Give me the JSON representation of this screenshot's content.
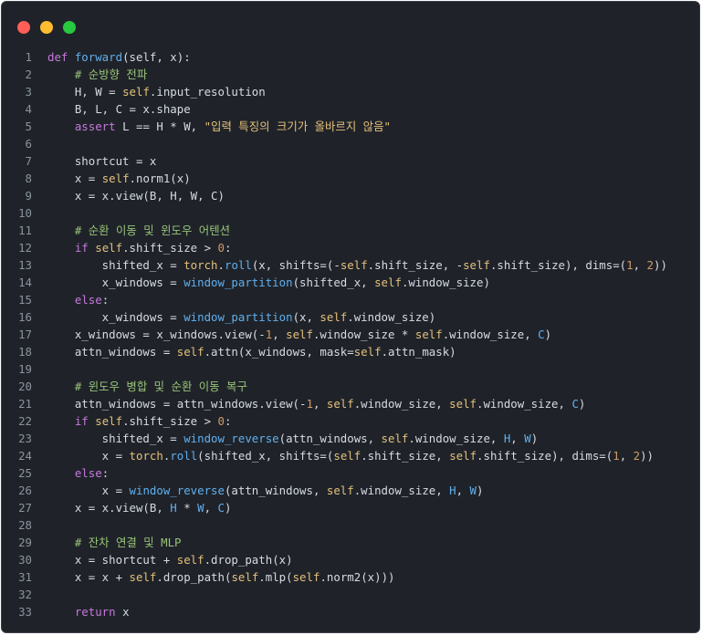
{
  "window": {
    "buttons": [
      {
        "name": "close",
        "color": "#ff5f57"
      },
      {
        "name": "minimize",
        "color": "#febc2e"
      },
      {
        "name": "zoom",
        "color": "#28c840"
      }
    ]
  },
  "theme": {
    "background": "#1f2329",
    "text": "#d6dbe2",
    "keyword": "#c678dd",
    "function": "#61afef",
    "comment": "#98c379",
    "string": "#e5c07b",
    "number": "#d19a66",
    "line_number": "#8b939e"
  },
  "code": {
    "lines": [
      {
        "n": "1",
        "tokens": [
          [
            "kw",
            "def "
          ],
          [
            "fn",
            "forward"
          ],
          [
            "op",
            "(self, x):"
          ]
        ]
      },
      {
        "n": "2",
        "tokens": [
          [
            "op",
            "    "
          ],
          [
            "cm",
            "# 순방향 전파"
          ]
        ]
      },
      {
        "n": "3",
        "tokens": [
          [
            "op",
            "    H, W = "
          ],
          [
            "self",
            "self"
          ],
          [
            "op",
            ".input_resolution"
          ]
        ]
      },
      {
        "n": "4",
        "tokens": [
          [
            "op",
            "    B, L, C = x.shape"
          ]
        ]
      },
      {
        "n": "5",
        "tokens": [
          [
            "op",
            "    "
          ],
          [
            "kw",
            "assert "
          ],
          [
            "op",
            "L == H * W, "
          ],
          [
            "str",
            "\"입력 특징의 크기가 올바르지 않음\""
          ]
        ]
      },
      {
        "n": "6",
        "tokens": []
      },
      {
        "n": "7",
        "tokens": [
          [
            "op",
            "    shortcut = x"
          ]
        ]
      },
      {
        "n": "8",
        "tokens": [
          [
            "op",
            "    x = "
          ],
          [
            "self",
            "self"
          ],
          [
            "op",
            ".norm1(x)"
          ]
        ]
      },
      {
        "n": "9",
        "tokens": [
          [
            "op",
            "    x = x.view(B, H, W, C)"
          ]
        ]
      },
      {
        "n": "10",
        "tokens": []
      },
      {
        "n": "11",
        "tokens": [
          [
            "op",
            "    "
          ],
          [
            "cm",
            "# 순환 이동 및 윈도우 어텐션"
          ]
        ]
      },
      {
        "n": "12",
        "tokens": [
          [
            "op",
            "    "
          ],
          [
            "kw",
            "if "
          ],
          [
            "self",
            "self"
          ],
          [
            "op",
            ".shift_size > "
          ],
          [
            "num",
            "0"
          ],
          [
            "op",
            ":"
          ]
        ]
      },
      {
        "n": "13",
        "tokens": [
          [
            "op",
            "        shifted_x = "
          ],
          [
            "mod",
            "torch"
          ],
          [
            "op",
            "."
          ],
          [
            "fn",
            "roll"
          ],
          [
            "op",
            "(x, shifts=(-"
          ],
          [
            "self",
            "self"
          ],
          [
            "op",
            ".shift_size, -"
          ],
          [
            "self",
            "self"
          ],
          [
            "op",
            ".shift_size), dims=("
          ],
          [
            "num",
            "1"
          ],
          [
            "op",
            ", "
          ],
          [
            "num",
            "2"
          ],
          [
            "op",
            "))"
          ]
        ]
      },
      {
        "n": "14",
        "tokens": [
          [
            "op",
            "        x_windows = "
          ],
          [
            "fn",
            "window_partition"
          ],
          [
            "op",
            "(shifted_x, "
          ],
          [
            "self",
            "self"
          ],
          [
            "op",
            ".window_size)"
          ]
        ]
      },
      {
        "n": "15",
        "tokens": [
          [
            "op",
            "    "
          ],
          [
            "kw",
            "else"
          ],
          [
            "op",
            ":"
          ]
        ]
      },
      {
        "n": "16",
        "tokens": [
          [
            "op",
            "        x_windows = "
          ],
          [
            "fn",
            "window_partition"
          ],
          [
            "op",
            "(x, "
          ],
          [
            "self",
            "self"
          ],
          [
            "op",
            ".window_size)"
          ]
        ]
      },
      {
        "n": "17",
        "tokens": [
          [
            "op",
            "    x_windows = x_windows.view(-"
          ],
          [
            "num",
            "1"
          ],
          [
            "op",
            ", "
          ],
          [
            "self",
            "self"
          ],
          [
            "op",
            ".window_size * "
          ],
          [
            "self",
            "self"
          ],
          [
            "op",
            ".window_size, "
          ],
          [
            "cap",
            "C"
          ],
          [
            "op",
            ")"
          ]
        ]
      },
      {
        "n": "18",
        "tokens": [
          [
            "op",
            "    attn_windows = "
          ],
          [
            "self",
            "self"
          ],
          [
            "op",
            ".attn(x_windows, mask="
          ],
          [
            "self",
            "self"
          ],
          [
            "op",
            ".attn_mask)"
          ]
        ]
      },
      {
        "n": "19",
        "tokens": []
      },
      {
        "n": "20",
        "tokens": [
          [
            "op",
            "    "
          ],
          [
            "cm",
            "# 윈도우 병합 및 순환 이동 복구"
          ]
        ]
      },
      {
        "n": "21",
        "tokens": [
          [
            "op",
            "    attn_windows = attn_windows.view(-"
          ],
          [
            "num",
            "1"
          ],
          [
            "op",
            ", "
          ],
          [
            "self",
            "self"
          ],
          [
            "op",
            ".window_size, "
          ],
          [
            "self",
            "self"
          ],
          [
            "op",
            ".window_size, "
          ],
          [
            "cap",
            "C"
          ],
          [
            "op",
            ")"
          ]
        ]
      },
      {
        "n": "22",
        "tokens": [
          [
            "op",
            "    "
          ],
          [
            "kw",
            "if "
          ],
          [
            "self",
            "self"
          ],
          [
            "op",
            ".shift_size > "
          ],
          [
            "num",
            "0"
          ],
          [
            "op",
            ":"
          ]
        ]
      },
      {
        "n": "23",
        "tokens": [
          [
            "op",
            "        shifted_x = "
          ],
          [
            "fn",
            "window_reverse"
          ],
          [
            "op",
            "(attn_windows, "
          ],
          [
            "self",
            "self"
          ],
          [
            "op",
            ".window_size, "
          ],
          [
            "cap",
            "H"
          ],
          [
            "op",
            ", "
          ],
          [
            "cap",
            "W"
          ],
          [
            "op",
            ")"
          ]
        ]
      },
      {
        "n": "24",
        "tokens": [
          [
            "op",
            "        x = "
          ],
          [
            "mod",
            "torch"
          ],
          [
            "op",
            "."
          ],
          [
            "fn",
            "roll"
          ],
          [
            "op",
            "(shifted_x, shifts=("
          ],
          [
            "self",
            "self"
          ],
          [
            "op",
            ".shift_size, "
          ],
          [
            "self",
            "self"
          ],
          [
            "op",
            ".shift_size), dims=("
          ],
          [
            "num",
            "1"
          ],
          [
            "op",
            ", "
          ],
          [
            "num",
            "2"
          ],
          [
            "op",
            "))"
          ]
        ]
      },
      {
        "n": "25",
        "tokens": [
          [
            "op",
            "    "
          ],
          [
            "kw",
            "else"
          ],
          [
            "op",
            ":"
          ]
        ]
      },
      {
        "n": "26",
        "tokens": [
          [
            "op",
            "        x = "
          ],
          [
            "fn",
            "window_reverse"
          ],
          [
            "op",
            "(attn_windows, "
          ],
          [
            "self",
            "self"
          ],
          [
            "op",
            ".window_size, "
          ],
          [
            "cap",
            "H"
          ],
          [
            "op",
            ", "
          ],
          [
            "cap",
            "W"
          ],
          [
            "op",
            ")"
          ]
        ]
      },
      {
        "n": "27",
        "tokens": [
          [
            "op",
            "    x = x.view(B, "
          ],
          [
            "cap",
            "H"
          ],
          [
            "op",
            " * "
          ],
          [
            "cap",
            "W"
          ],
          [
            "op",
            ", "
          ],
          [
            "cap",
            "C"
          ],
          [
            "op",
            ")"
          ]
        ]
      },
      {
        "n": "28",
        "tokens": []
      },
      {
        "n": "29",
        "tokens": [
          [
            "op",
            "    "
          ],
          [
            "cm",
            "# 잔차 연결 및 MLP"
          ]
        ]
      },
      {
        "n": "30",
        "tokens": [
          [
            "op",
            "    x = shortcut + "
          ],
          [
            "self",
            "self"
          ],
          [
            "op",
            ".drop_path(x)"
          ]
        ]
      },
      {
        "n": "31",
        "tokens": [
          [
            "op",
            "    x = x + "
          ],
          [
            "self",
            "self"
          ],
          [
            "op",
            ".drop_path("
          ],
          [
            "self",
            "self"
          ],
          [
            "op",
            ".mlp("
          ],
          [
            "self",
            "self"
          ],
          [
            "op",
            ".norm2(x)))"
          ]
        ]
      },
      {
        "n": "32",
        "tokens": []
      },
      {
        "n": "33",
        "tokens": [
          [
            "op",
            "    "
          ],
          [
            "kw",
            "return "
          ],
          [
            "op",
            "x"
          ]
        ]
      }
    ]
  }
}
